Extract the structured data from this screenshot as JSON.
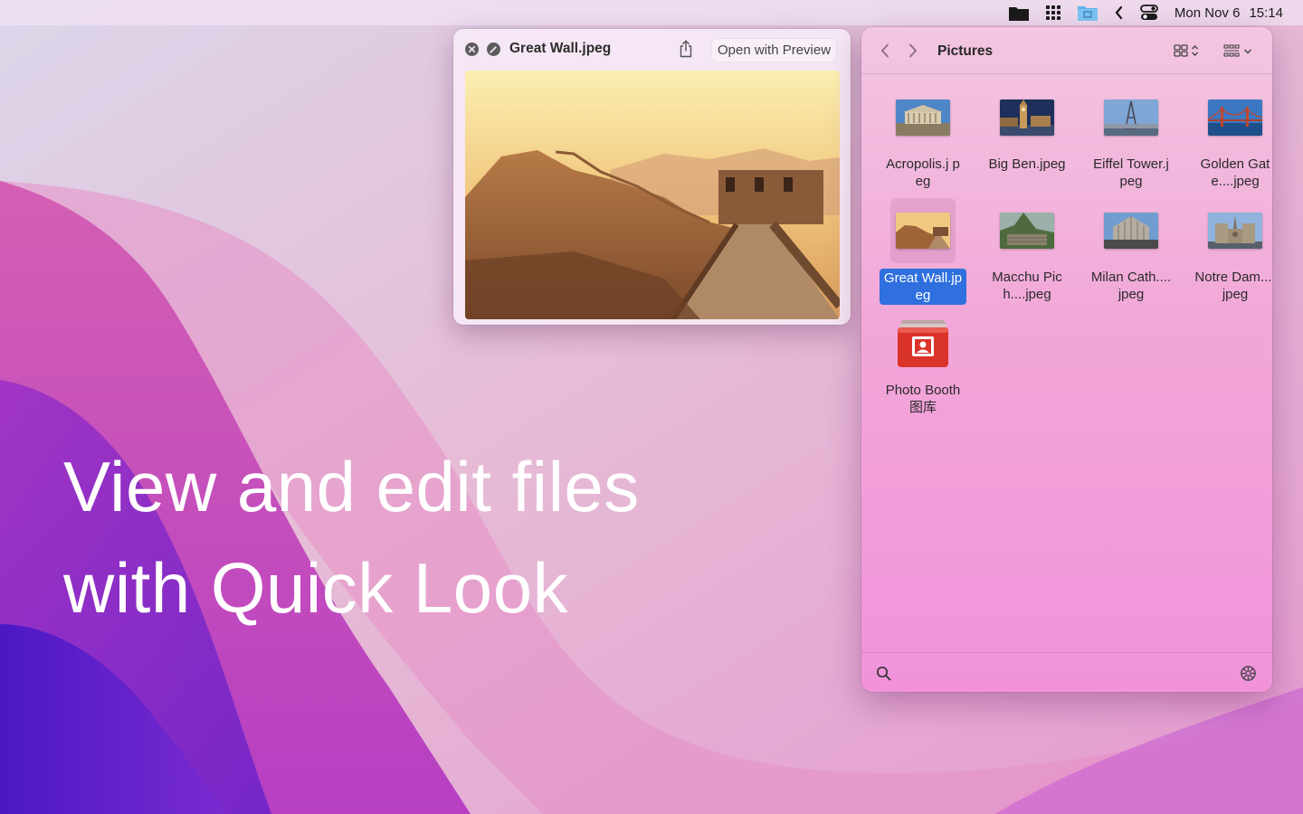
{
  "menubar": {
    "icons": [
      "folder-icon",
      "app-grid-icon",
      "finder-icon",
      "chevron-left-icon",
      "control-center-icon"
    ],
    "date": "Mon Nov 6",
    "time": "15:14"
  },
  "headline": {
    "line1": "View and edit files",
    "line2": "with Quick Look"
  },
  "quicklook": {
    "title": "Great Wall.jpeg",
    "open_button": "Open with Preview"
  },
  "finder": {
    "title": "Pictures",
    "files": [
      {
        "name": "Acropolis.jpeg",
        "label": "Acropolis.j peg",
        "selected": false
      },
      {
        "name": "Big Ben.jpeg",
        "label": "Big Ben.jpeg",
        "selected": false
      },
      {
        "name": "Eiffel Tower.jpeg",
        "label": "Eiffel Tower.jpeg",
        "selected": false
      },
      {
        "name": "Golden Gate.jpeg",
        "label": "Golden Gate....jpeg",
        "selected": false
      },
      {
        "name": "Great Wall.jpeg",
        "label": "Great Wall.jpeg",
        "selected": true
      },
      {
        "name": "Macchu Picchu.jpeg",
        "label": "Macchu Pich....jpeg",
        "selected": false
      },
      {
        "name": "Milan Cathedral.jpeg",
        "label": "Milan Cath....jpeg",
        "selected": false
      },
      {
        "name": "Notre Dame.jpeg",
        "label": "Notre Dam....jpeg",
        "selected": false
      },
      {
        "name": "Photo Booth图库",
        "label": "Photo Booth图库",
        "selected": false
      }
    ]
  },
  "colors": {
    "selection": "#2f6fde",
    "headline": "#ffffff"
  }
}
